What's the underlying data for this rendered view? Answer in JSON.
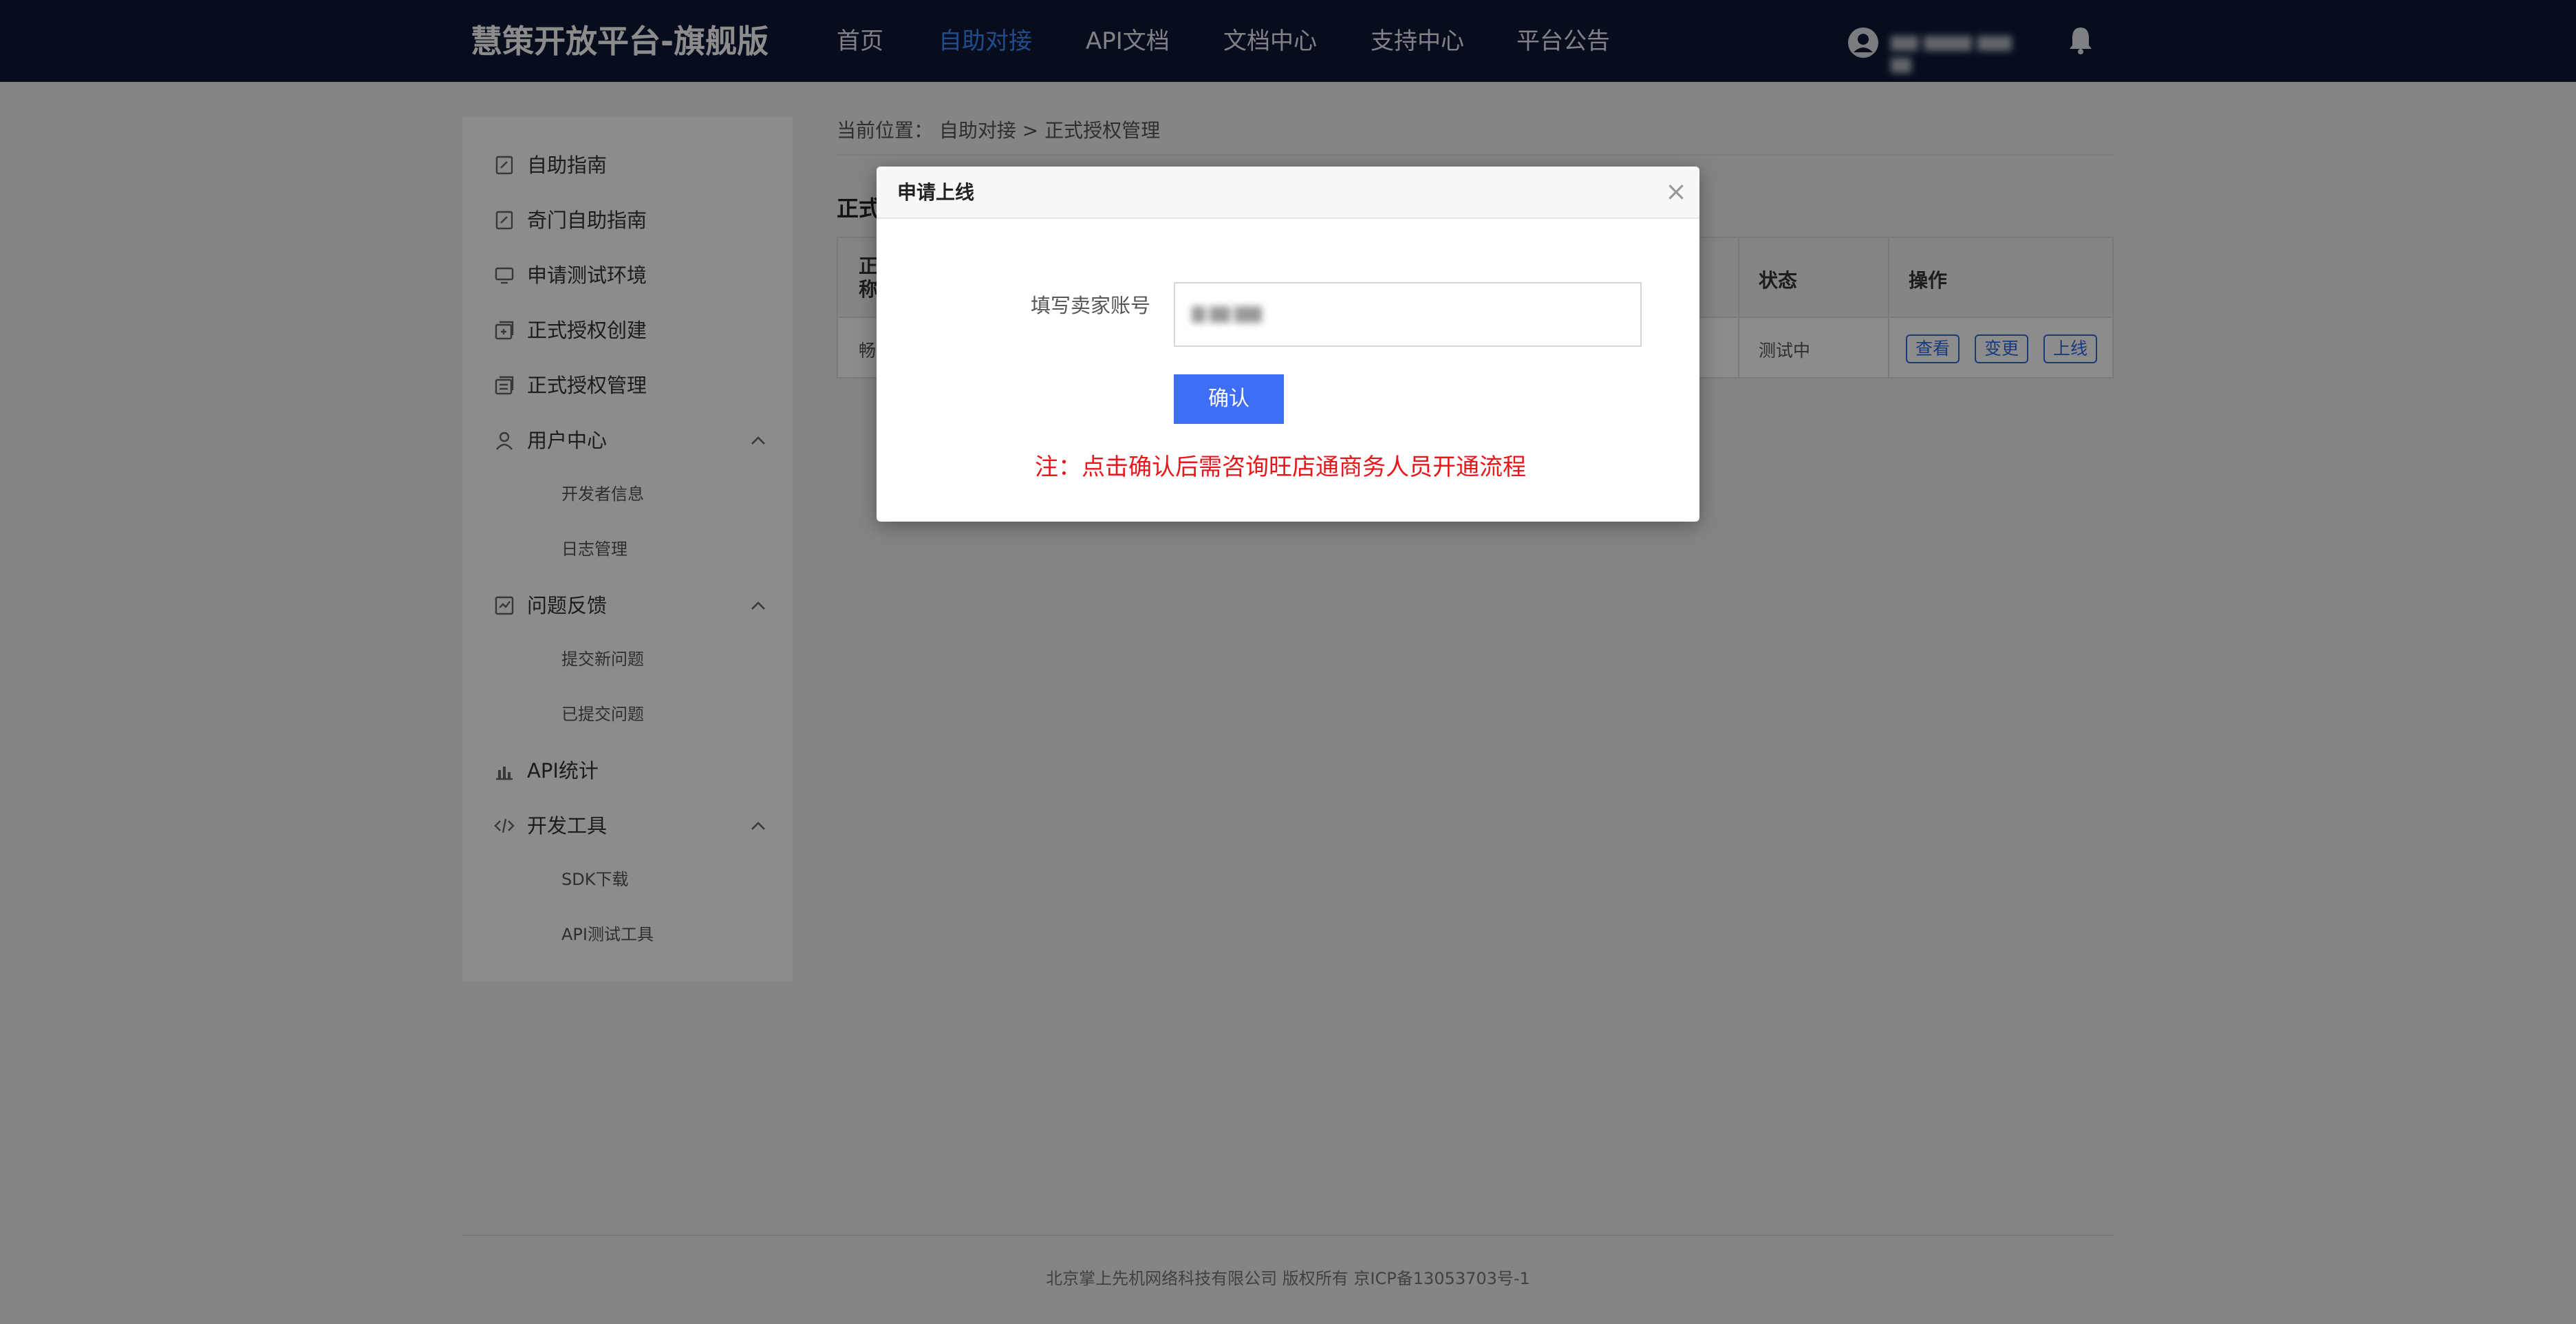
{
  "header": {
    "brand": "慧策开放平台-旗舰版",
    "nav": [
      "首页",
      "自助对接",
      "API文档",
      "文档中心",
      "支持中心",
      "平台公告"
    ],
    "active_nav": "自助对接"
  },
  "sidebar": {
    "items": [
      {
        "label": "自助指南",
        "icon": "edit-doc-icon"
      },
      {
        "label": "奇门自助指南",
        "icon": "edit-doc-icon"
      },
      {
        "label": "申请测试环境",
        "icon": "monitor-icon"
      },
      {
        "label": "正式授权创建",
        "icon": "create-auth-icon"
      },
      {
        "label": "正式授权管理",
        "icon": "manage-auth-icon"
      },
      {
        "label": "用户中心",
        "icon": "user-icon"
      },
      {
        "label": "开发者信息"
      },
      {
        "label": "日志管理"
      },
      {
        "label": "问题反馈",
        "icon": "feedback-icon"
      },
      {
        "label": "提交新问题"
      },
      {
        "label": "已提交问题"
      },
      {
        "label": "API统计",
        "icon": "bar-chart-icon"
      },
      {
        "label": "开发工具",
        "icon": "code-icon"
      },
      {
        "label": "SDK下载"
      },
      {
        "label": "API测试工具"
      }
    ]
  },
  "main": {
    "breadcrumb": "当前位置： 自助对接 > 正式授权管理",
    "section_title": "正式",
    "table": {
      "head_first": "正\n称",
      "head_status": "状态",
      "head_ops": "操作",
      "row_first": "畅",
      "row_status": "测试中",
      "ops": [
        "查看",
        "变更",
        "上线"
      ]
    }
  },
  "footer": {
    "text": "北京掌上先机网络科技有限公司 版权所有 京ICP备13053703号-1"
  },
  "modal": {
    "title": "申请上线",
    "close": "×",
    "field_label": "填写卖家账号",
    "confirm": "确认",
    "note": "注：点击确认后需咨询旺店通商务人员开通流程"
  },
  "colors": {
    "topbar": "#0d1936",
    "active_nav": "#3d8bff",
    "primary_button": "#3d6ef5",
    "note_red": "#e8171b"
  }
}
